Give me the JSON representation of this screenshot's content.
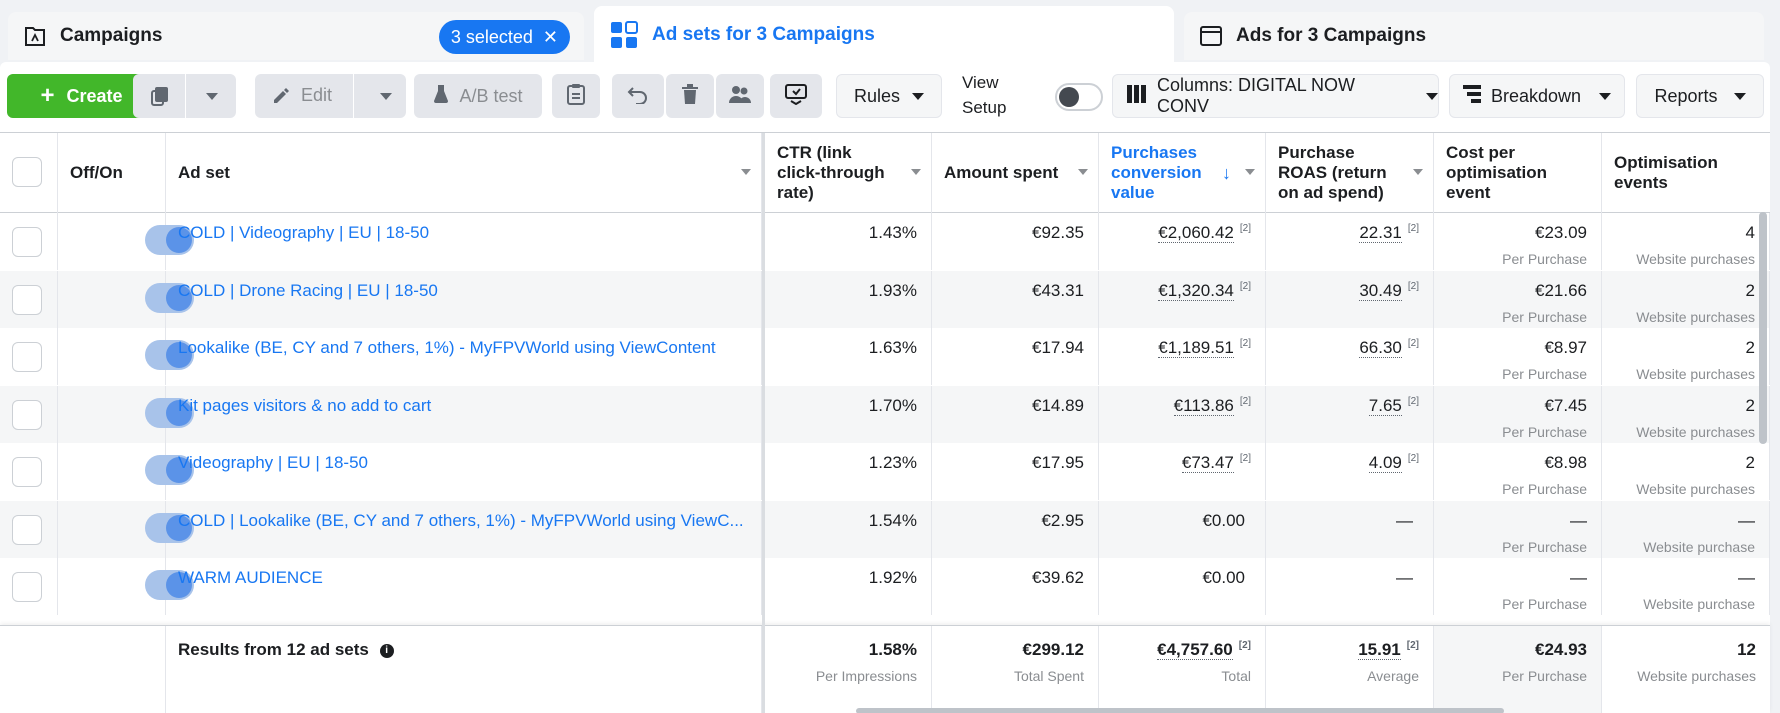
{
  "tabs": {
    "campaigns": {
      "label": "Campaigns",
      "badge": "3 selected"
    },
    "adsets": {
      "label": "Ad sets for 3 Campaigns"
    },
    "ads": {
      "label": "Ads for 3 Campaigns"
    }
  },
  "toolbar": {
    "create": "Create",
    "edit": "Edit",
    "abtest": "A/B test",
    "rules": "Rules",
    "view_setup_1": "View",
    "view_setup_2": "Setup",
    "columns": "Columns: DIGITAL NOW CONV",
    "breakdown": "Breakdown",
    "reports": "Reports"
  },
  "headers": {
    "offon": "Off/On",
    "adset": "Ad set",
    "ctr": "CTR (link click-through rate)",
    "spent": "Amount spent",
    "pcv": "Purchases conversion value",
    "roas": "Purchase ROAS (return on ad spend)",
    "cpoe": "Cost per optimisation event",
    "oe": "Optimisation events"
  },
  "rows": [
    {
      "name": "COLD | Videography | EU | 18-50",
      "ctr": "1.43%",
      "spent": "€92.35",
      "pcv": "€2,060.42",
      "pcv_sup": "[2]",
      "roas": "22.31",
      "roas_sup": "[2]",
      "cpoe": "€23.09",
      "cpoe_sub": "Per Purchase",
      "oe": "4",
      "oe_sub": "Website purchases"
    },
    {
      "name": "COLD | Drone Racing | EU | 18-50",
      "ctr": "1.93%",
      "spent": "€43.31",
      "pcv": "€1,320.34",
      "pcv_sup": "[2]",
      "roas": "30.49",
      "roas_sup": "[2]",
      "cpoe": "€21.66",
      "cpoe_sub": "Per Purchase",
      "oe": "2",
      "oe_sub": "Website purchases"
    },
    {
      "name": "Lookalike (BE, CY and 7 others, 1%) - MyFPVWorld using ViewContent",
      "ctr": "1.63%",
      "spent": "€17.94",
      "pcv": "€1,189.51",
      "pcv_sup": "[2]",
      "roas": "66.30",
      "roas_sup": "[2]",
      "cpoe": "€8.97",
      "cpoe_sub": "Per Purchase",
      "oe": "2",
      "oe_sub": "Website purchases"
    },
    {
      "name": "Kit pages visitors & no add to cart",
      "ctr": "1.70%",
      "spent": "€14.89",
      "pcv": "€113.86",
      "pcv_sup": "[2]",
      "roas": "7.65",
      "roas_sup": "[2]",
      "cpoe": "€7.45",
      "cpoe_sub": "Per Purchase",
      "oe": "2",
      "oe_sub": "Website purchases"
    },
    {
      "name": "Videography | EU | 18-50",
      "ctr": "1.23%",
      "spent": "€17.95",
      "pcv": "€73.47",
      "pcv_sup": "[2]",
      "roas": "4.09",
      "roas_sup": "[2]",
      "cpoe": "€8.98",
      "cpoe_sub": "Per Purchase",
      "oe": "2",
      "oe_sub": "Website purchases"
    },
    {
      "name": "COLD | Lookalike (BE, CY and 7 others, 1%) - MyFPVWorld using ViewC...",
      "ctr": "1.54%",
      "spent": "€2.95",
      "pcv": "€0.00",
      "pcv_sup": "",
      "roas": "—",
      "roas_sup": "",
      "cpoe": "—",
      "cpoe_sub": "Per Purchase",
      "oe": "—",
      "oe_sub": "Website purchase"
    },
    {
      "name": "WARM AUDIENCE",
      "ctr": "1.92%",
      "spent": "€39.62",
      "pcv": "€0.00",
      "pcv_sup": "",
      "roas": "—",
      "roas_sup": "",
      "cpoe": "—",
      "cpoe_sub": "Per Purchase",
      "oe": "—",
      "oe_sub": "Website purchase"
    }
  ],
  "footer": {
    "label": "Results from 12 ad sets",
    "ctr": "1.58%",
    "ctr_sub": "Per Impressions",
    "spent": "€299.12",
    "spent_sub": "Total Spent",
    "pcv": "€4,757.60",
    "pcv_sup": "[2]",
    "pcv_sub": "Total",
    "roas": "15.91",
    "roas_sup": "[2]",
    "roas_sub": "Average",
    "cpoe": "€24.93",
    "cpoe_sub": "Per Purchase",
    "oe": "12",
    "oe_sub": "Website purchases"
  },
  "colors": {
    "accent": "#1877f2",
    "create": "#42b72a"
  }
}
